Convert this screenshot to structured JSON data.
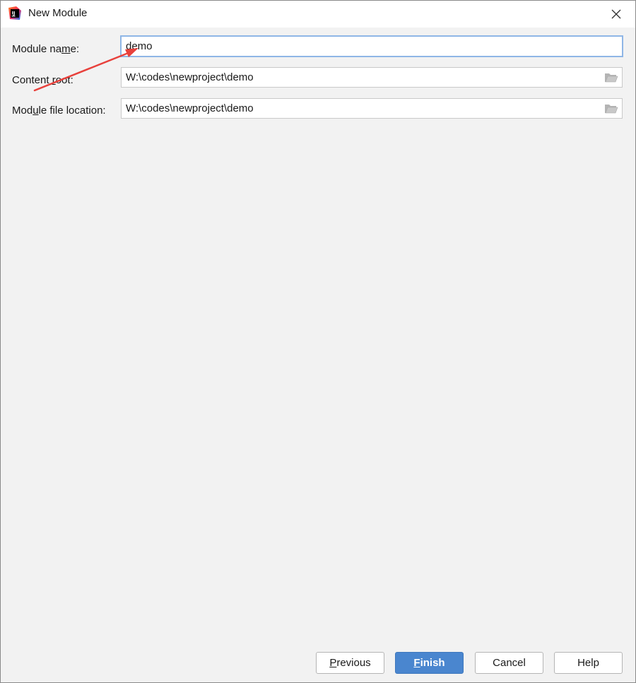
{
  "window": {
    "title": "New Module",
    "icon": "intellij-idea-icon",
    "close_icon": "close-icon"
  },
  "form": {
    "module_name": {
      "label_pre": "Module na",
      "label_mnemonic": "m",
      "label_post": "e:",
      "value": "demo"
    },
    "content_root": {
      "label_pre": "Content ",
      "label_mnemonic": "r",
      "label_post": "oot:",
      "value": "W:\\codes\\newproject\\demo",
      "browse_icon": "folder-icon"
    },
    "module_file_location": {
      "label_pre": "Mod",
      "label_mnemonic": "u",
      "label_post": "le file location:",
      "value": "W:\\codes\\newproject\\demo",
      "browse_icon": "folder-icon"
    }
  },
  "annotation": {
    "arrow_color": "#e8413c"
  },
  "buttons": {
    "previous": {
      "mnemonic": "P",
      "rest": "revious"
    },
    "finish": {
      "mnemonic": "F",
      "rest": "inish"
    },
    "cancel": {
      "label": "Cancel"
    },
    "help": {
      "label": "Help"
    }
  },
  "colors": {
    "primary_button": "#4a86cf",
    "focus_border": "#8fb6e6",
    "background": "#f2f2f2"
  }
}
